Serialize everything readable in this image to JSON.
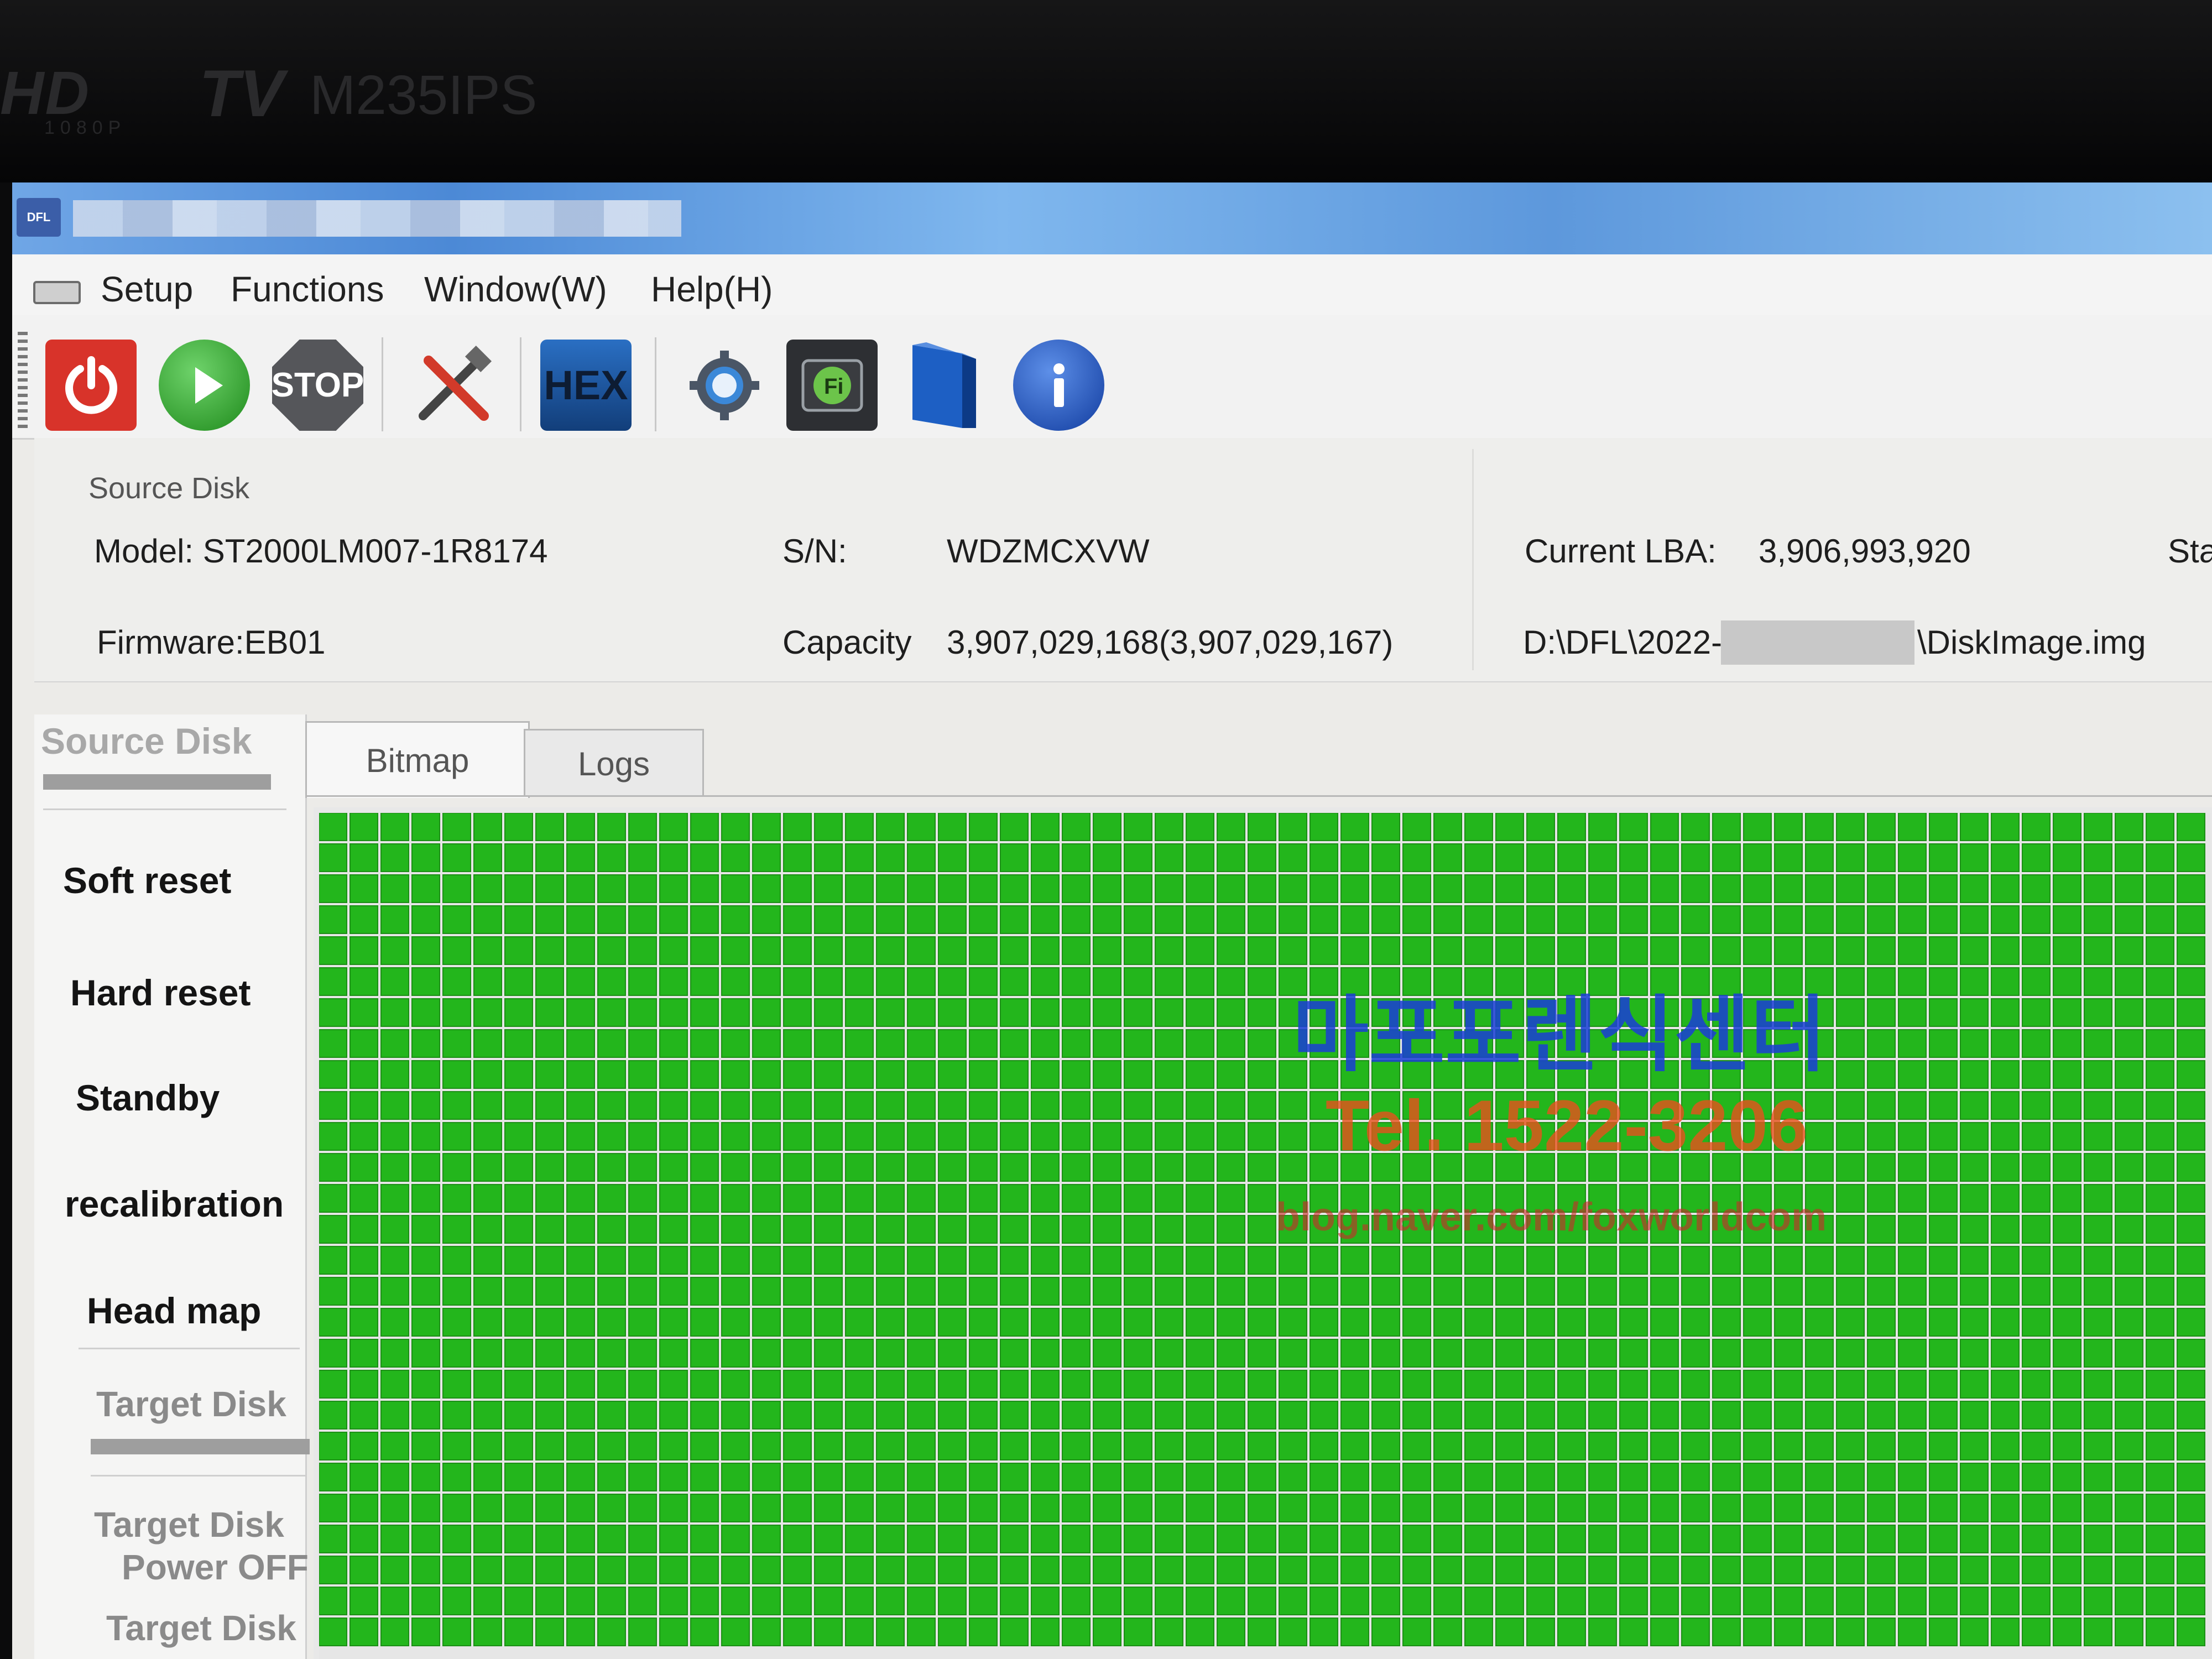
{
  "bezel": {
    "brand_hd": "HD",
    "brand_res": "1080P",
    "brand_tv": "TV",
    "model": "M235IPS"
  },
  "app": {
    "icon_label": "DFL"
  },
  "menu": {
    "items": [
      "Setup",
      "Functions",
      "Window(W)",
      "Help(H)"
    ]
  },
  "toolbar": {
    "stop_label": "STOP",
    "hex_label": "HEX",
    "icons": [
      "power-icon",
      "play-icon",
      "stop-icon",
      "tools-icon",
      "hex-icon",
      "gear-icon",
      "firmware-icon",
      "book-icon",
      "info-icon"
    ],
    "colors": {
      "power": "#d8332a",
      "play": "#2fa12c",
      "stop": "#55565a",
      "hex": "#1b4f93",
      "info": "#1d55c5"
    }
  },
  "source_disk": {
    "group_label": "Source Disk",
    "model": "Model: ST2000LM007-1R8174",
    "firmware": "Firmware:EB01",
    "sn_label": "S/N:",
    "sn_value": "WDZMCXVW",
    "capacity_label": "Capacity",
    "capacity_value": "3,907,029,168(3,907,029,167)",
    "current_lba_label": "Current LBA:",
    "current_lba_value": "3,906,993,920",
    "path_prefix": "D:\\DFL\\2022-",
    "path_suffix": "\\DiskImage.img",
    "status_label": "Stat"
  },
  "side_panel": {
    "source_head": "Source Disk",
    "buttons": [
      "Soft reset",
      "Hard reset",
      "Standby",
      "recalibration",
      "Head map"
    ],
    "target_head": "Target Disk",
    "target_power_line1": "Target Disk",
    "target_power_line2": "Power OFF",
    "target_last": "Target Disk"
  },
  "tabs": [
    "Bitmap",
    "Logs"
  ],
  "bitmap": {
    "cell_color": "#23b61c",
    "grid_color": "#e6e6e6"
  },
  "watermark": {
    "name": "마포포렌식센터",
    "tel": "Tel. 1522-3206",
    "blog": "blog.naver.com/foxworldcom",
    "colors": {
      "name": "#1a3fd6",
      "tel": "#e8521c",
      "blog": "#cc2a2a"
    }
  }
}
